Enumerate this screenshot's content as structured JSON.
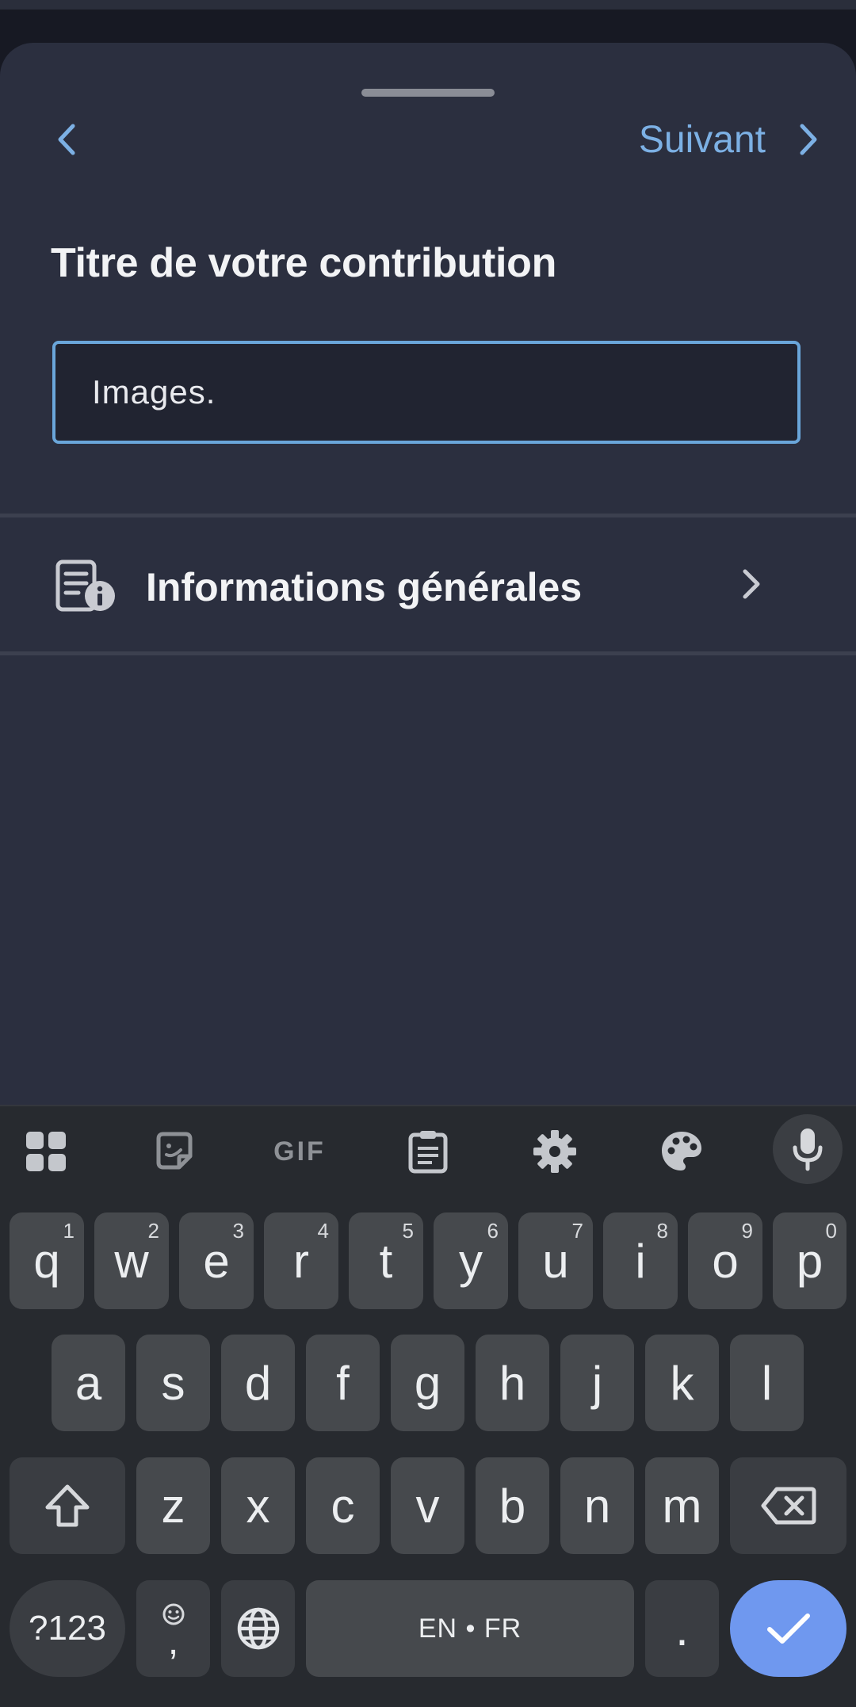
{
  "header": {
    "back_icon": "chevron-left-icon",
    "next_label": "Suivant",
    "next_icon": "chevron-right-icon"
  },
  "form": {
    "title": "Titre de votre contribution",
    "input_value": "Images."
  },
  "sections": [
    {
      "label": "Informations générales",
      "icon": "document-info-icon"
    }
  ],
  "keyboard": {
    "toolbar": [
      "apps-grid-icon",
      "sticker-icon",
      "gif-icon",
      "clipboard-icon",
      "settings-icon",
      "palette-icon",
      "mic-icon"
    ],
    "toolbar_gif_label": "GIF",
    "row1": [
      {
        "k": "q",
        "n": "1"
      },
      {
        "k": "w",
        "n": "2"
      },
      {
        "k": "e",
        "n": "3"
      },
      {
        "k": "r",
        "n": "4"
      },
      {
        "k": "t",
        "n": "5"
      },
      {
        "k": "y",
        "n": "6"
      },
      {
        "k": "u",
        "n": "7"
      },
      {
        "k": "i",
        "n": "8"
      },
      {
        "k": "o",
        "n": "9"
      },
      {
        "k": "p",
        "n": "0"
      }
    ],
    "row2": [
      "a",
      "s",
      "d",
      "f",
      "g",
      "h",
      "j",
      "k",
      "l"
    ],
    "row3": [
      "z",
      "x",
      "c",
      "v",
      "b",
      "n",
      "m"
    ],
    "symbols_label": "?123",
    "comma_label": ",",
    "space_label": "EN • FR",
    "period_label": ".",
    "accent_color": "#6f98ef"
  }
}
